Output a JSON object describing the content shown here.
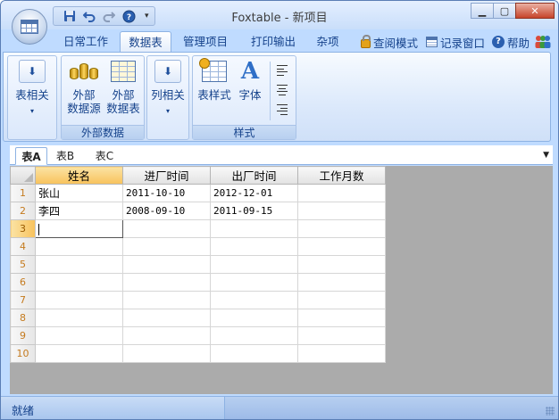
{
  "window": {
    "title": "Foxtable - 新项目"
  },
  "quick_access": {
    "dropdown_glyph": "▾"
  },
  "window_controls": {
    "minimize": "▁",
    "maximize": "▢",
    "close": "✕"
  },
  "ribbon_tabs": [
    {
      "label": "日常工作",
      "active": false
    },
    {
      "label": "数据表",
      "active": true
    },
    {
      "label": "管理项目",
      "active": false
    },
    {
      "label": "打印输出",
      "active": false
    },
    {
      "label": "杂项",
      "active": false
    }
  ],
  "ribbon_links": {
    "view_mode": "查阅模式",
    "record_window": "记录窗口",
    "help": "帮助"
  },
  "ribbon_groups": {
    "table": {
      "button_label": "表相关"
    },
    "external": {
      "label": "外部数据",
      "source_label": "外部\n数据源",
      "table_label": "外部\n数据表"
    },
    "column": {
      "button_label": "列相关"
    },
    "style": {
      "label": "样式",
      "table_style_label": "表样式",
      "font_label": "字体"
    }
  },
  "sheet_tabs": [
    {
      "label": "表A",
      "active": true
    },
    {
      "label": "表B",
      "active": false
    },
    {
      "label": "表C",
      "active": false
    }
  ],
  "grid": {
    "columns": [
      "姓名",
      "进厂时间",
      "出厂时间",
      "工作月数"
    ],
    "rows": [
      {
        "num": "1",
        "cells": [
          "张山",
          "2011-10-10",
          "2012-12-01",
          ""
        ]
      },
      {
        "num": "2",
        "cells": [
          "李四",
          "2008-09-10",
          "2011-09-15",
          ""
        ]
      },
      {
        "num": "3",
        "cells": [
          "",
          "",
          "",
          ""
        ]
      },
      {
        "num": "4",
        "cells": [
          "",
          "",
          "",
          ""
        ]
      },
      {
        "num": "5",
        "cells": [
          "",
          "",
          "",
          ""
        ]
      },
      {
        "num": "6",
        "cells": [
          "",
          "",
          "",
          ""
        ]
      },
      {
        "num": "7",
        "cells": [
          "",
          "",
          "",
          ""
        ]
      },
      {
        "num": "8",
        "cells": [
          "",
          "",
          "",
          ""
        ]
      },
      {
        "num": "9",
        "cells": [
          "",
          "",
          "",
          ""
        ]
      },
      {
        "num": "10",
        "cells": [
          "",
          "",
          "",
          ""
        ]
      }
    ],
    "current_row": 3
  },
  "status": {
    "text": "就绪"
  },
  "colors": {
    "ribbon_blue": "#bfdbff",
    "text_blue": "#15428b",
    "selection_orange": "#f8c25c",
    "grid_background": "#ababab"
  }
}
